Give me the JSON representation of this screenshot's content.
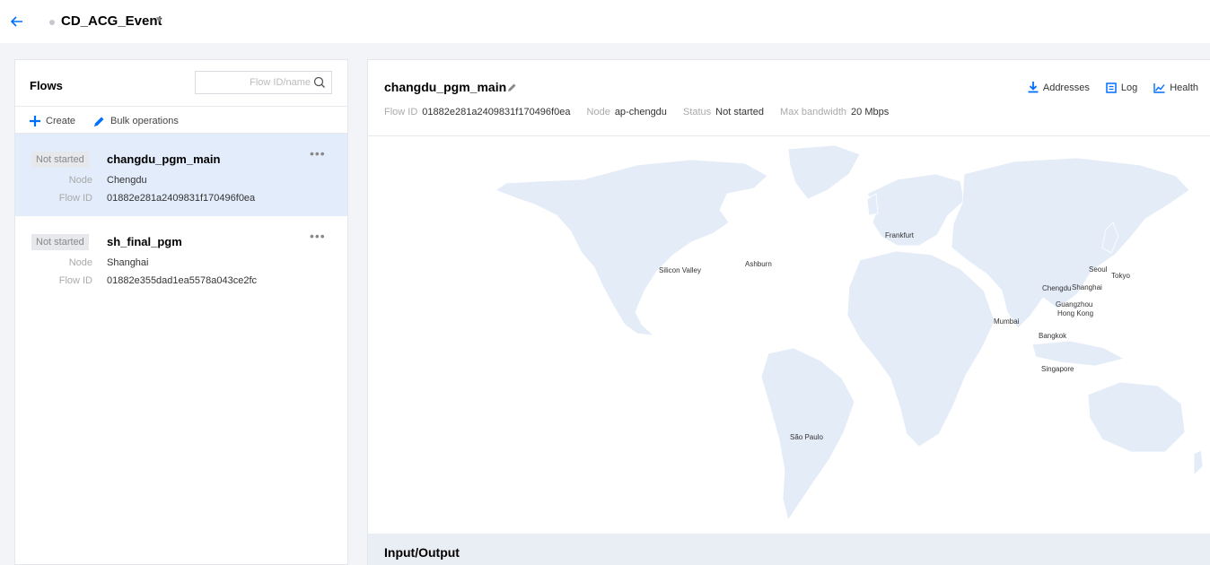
{
  "header": {
    "event_name": "CD_ACG_Event",
    "accent_color": "#006eff"
  },
  "left_panel": {
    "title": "Flows",
    "search_placeholder": "Flow ID/name",
    "create_label": "Create",
    "bulk_label": "Bulk operations",
    "node_key": "Node",
    "flowid_key": "Flow ID",
    "flows": [
      {
        "status": "Not started",
        "name": "changdu_pgm_main",
        "node": "Chengdu",
        "flow_id": "01882e281a2409831f170496f0ea",
        "selected": true
      },
      {
        "status": "Not started",
        "name": "sh_final_pgm",
        "node": "Shanghai",
        "flow_id": "01882e355dad1ea5578a043ce2fc",
        "selected": false
      }
    ]
  },
  "detail": {
    "title": "changdu_pgm_main",
    "actions": {
      "addresses": "Addresses",
      "log": "Log",
      "health": "Health"
    },
    "meta": {
      "flow_id_key": "Flow ID",
      "flow_id": "01882e281a2409831f170496f0ea",
      "node_key": "Node",
      "node": "ap-chengdu",
      "status_key": "Status",
      "status": "Not started",
      "bandwidth_key": "Max bandwidth",
      "bandwidth": "20 Mbps"
    },
    "map_cities": [
      "Frankfurt",
      "Ashburn",
      "Silicon Valley",
      "Seoul",
      "Tokyo",
      "Chengdu",
      "Shanghai",
      "Guangzhou",
      "Hong Kong",
      "Mumbai",
      "Bangkok",
      "Singapore",
      "São Paulo"
    ],
    "io_title": "Input/Output"
  }
}
